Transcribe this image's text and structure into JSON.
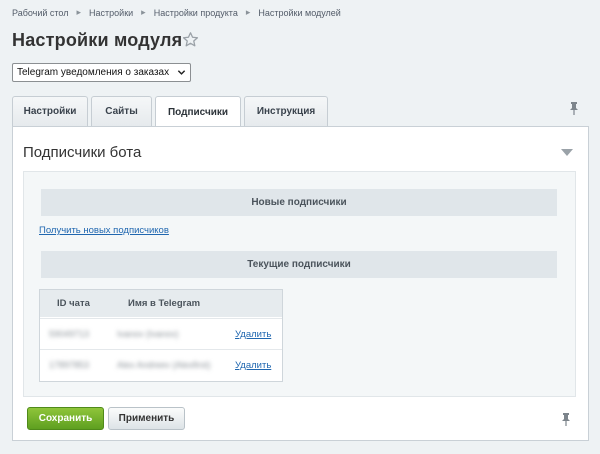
{
  "breadcrumb": [
    "Рабочий стол",
    "Настройки",
    "Настройки продукта",
    "Настройки модулей"
  ],
  "page": {
    "title": "Настройки модуля"
  },
  "module_select": {
    "value": "Telegram уведомления о заказах"
  },
  "tabs": [
    {
      "label": "Настройки",
      "active": false
    },
    {
      "label": "Сайты",
      "active": false
    },
    {
      "label": "Подписчики",
      "active": true
    },
    {
      "label": "Инструкция",
      "active": false
    }
  ],
  "panel": {
    "title": "Подписчики бота",
    "new_subscribers_header": "Новые подписчики",
    "get_new_link": "Получить новых подписчиков",
    "current_subscribers_header": "Текущие подписчики",
    "table": {
      "columns": [
        "ID чата",
        "Имя в Telegram"
      ],
      "rows": [
        {
          "id": "59049713",
          "name": "Ivanov (Ivanov)",
          "action": "Удалить"
        },
        {
          "id": "17897853",
          "name": "Alex Andreev (Alexfirst)",
          "action": "Удалить"
        }
      ]
    }
  },
  "buttons": {
    "save": "Сохранить",
    "apply": "Применить"
  },
  "colors": {
    "save_button": "#6aaa25",
    "link": "#2067b0",
    "page_bg": "#eef2f4"
  }
}
